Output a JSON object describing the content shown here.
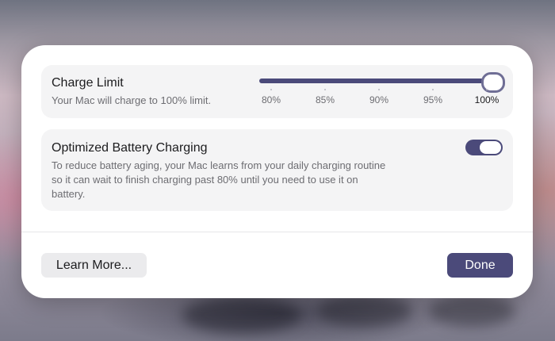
{
  "charge_limit": {
    "title": "Charge Limit",
    "description": "Your Mac will charge to 100% limit.",
    "slider": {
      "value_percent": 100,
      "min": 80,
      "max": 100,
      "ticks": [
        "80%",
        "85%",
        "90%",
        "95%",
        "100%"
      ]
    }
  },
  "optimized_charging": {
    "title": "Optimized Battery Charging",
    "description_lines": [
      "To reduce battery aging, your Mac learns from your daily charging routine",
      "so it can wait to finish charging past 80% until you need to use it on",
      "battery."
    ],
    "toggle_on": true
  },
  "buttons": {
    "learn_more": "Learn More...",
    "done": "Done"
  },
  "colors": {
    "accent": "#4b4a7a",
    "card_background": "#f4f4f5",
    "dialog_background": "#ffffff"
  }
}
